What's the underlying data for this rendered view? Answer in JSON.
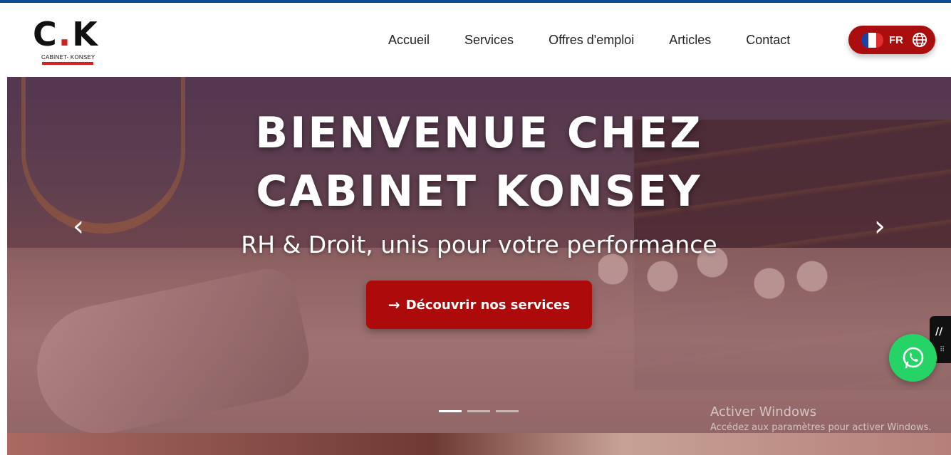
{
  "logo": {
    "mark_left": "C",
    "mark_dot": ".",
    "mark_right": "K",
    "subtitle": "CABINET- KONSEY"
  },
  "nav": {
    "items": [
      {
        "label": "Accueil"
      },
      {
        "label": "Services"
      },
      {
        "label": "Offres d'emploi"
      },
      {
        "label": "Articles"
      },
      {
        "label": "Contact"
      }
    ]
  },
  "language": {
    "code": "FR",
    "flag": "france-flag-icon",
    "icon": "globe-icon"
  },
  "hero": {
    "title_line1": "BIENVENUE CHEZ",
    "title_line2": "CABINET KONSEY",
    "subtitle": "RH & Droit, unis pour votre performance",
    "cta_arrow": "→",
    "cta_label": "Découvrir nos services",
    "prev_glyph": "‹",
    "next_glyph": "›",
    "slide_count": 3,
    "active_slide": 1
  },
  "windows_watermark": {
    "line1": "Activer Windows",
    "line2": "Accédez aux paramètres pour activer Windows."
  },
  "colors": {
    "brand_red": "#ad0b0b",
    "top_line": "#0d4f96",
    "whatsapp_green": "#25d366"
  },
  "icons": {
    "whatsapp": "whatsapp-icon",
    "side_widget": "widget-logo-icon"
  }
}
